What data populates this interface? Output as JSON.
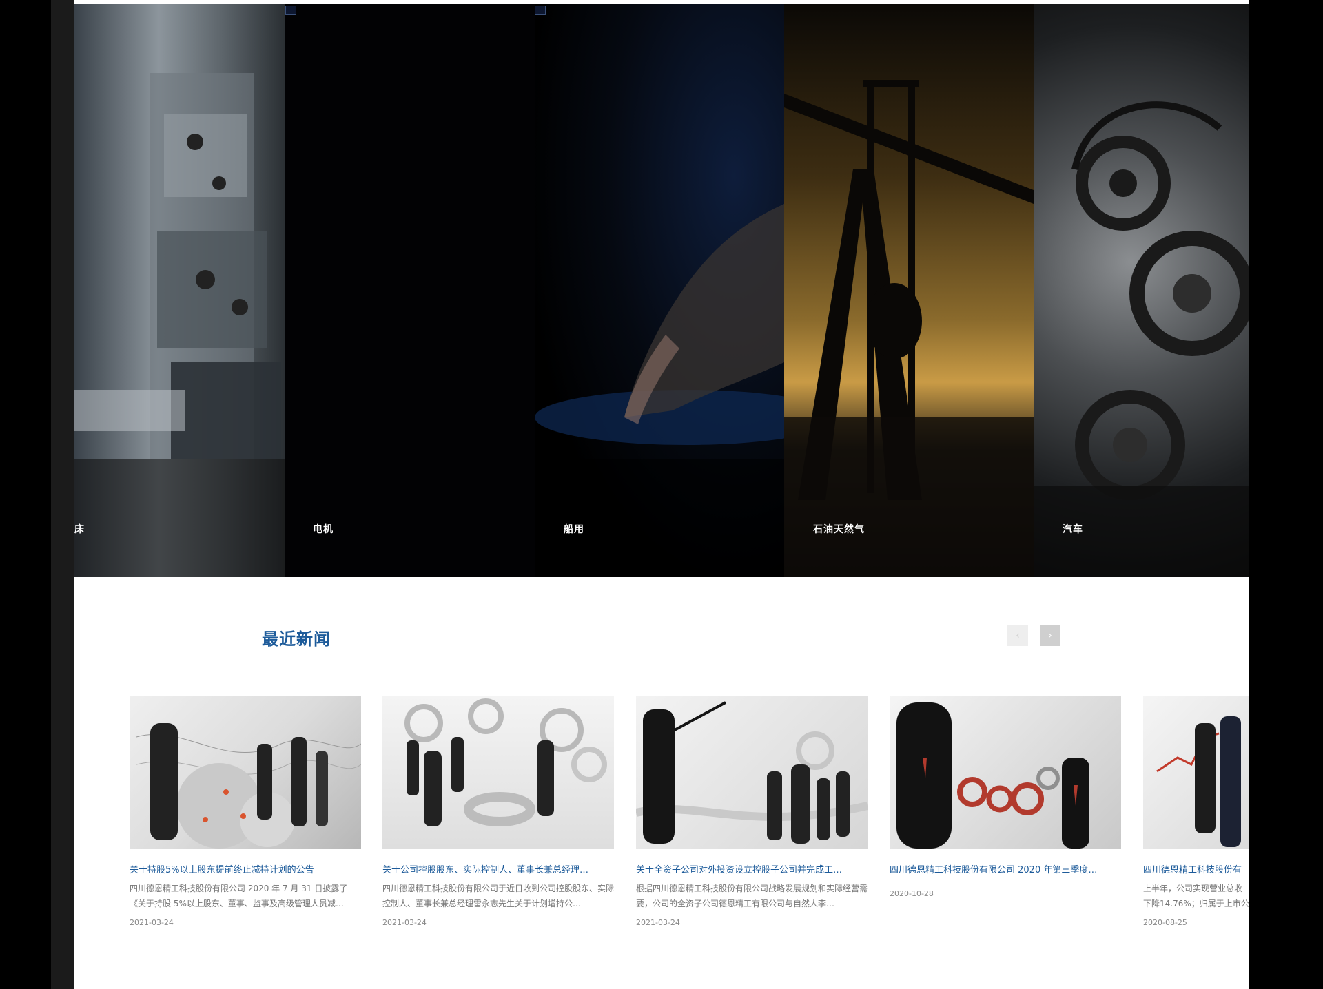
{
  "banner": {
    "panels": [
      {
        "label": "床"
      },
      {
        "label": "电机"
      },
      {
        "label": "船用"
      },
      {
        "label": "石油天然气"
      },
      {
        "label": "汽车"
      }
    ]
  },
  "news": {
    "title": "最近新闻",
    "prev_label": "‹",
    "next_label": "›",
    "items": [
      {
        "title": "关于持股5%以上股东提前终止减持计划的公告",
        "desc": "四川德恩精工科技股份有限公司 2020 年 7 月 31 日披露了《关于持股 5%以上股东、董事、监事及高级管理人员减…",
        "date": "2021-03-24"
      },
      {
        "title": "关于公司控股股东、实际控制人、董事长兼总经理…",
        "desc": "四川德恩精工科技股份有限公司于近日收到公司控股股东、实际控制人、董事长兼总经理雷永志先生关于计划增持公…",
        "date": "2021-03-24"
      },
      {
        "title": "关于全资子公司对外投资设立控股子公司并完成工…",
        "desc": "根据四川德恩精工科技股份有限公司战略发展规划和实际经营需要，公司的全资子公司德恩精工有限公司与自然人李…",
        "date": "2021-03-24"
      },
      {
        "title": "四川德恩精工科技股份有限公司 2020 年第三季度…",
        "desc": "",
        "date": "2020-10-28"
      },
      {
        "title": "四川德恩精工科技股份有",
        "desc": "上半年，公司实现营业总收下降14.76%；归属于上市公",
        "date": "2020-08-25"
      }
    ]
  }
}
